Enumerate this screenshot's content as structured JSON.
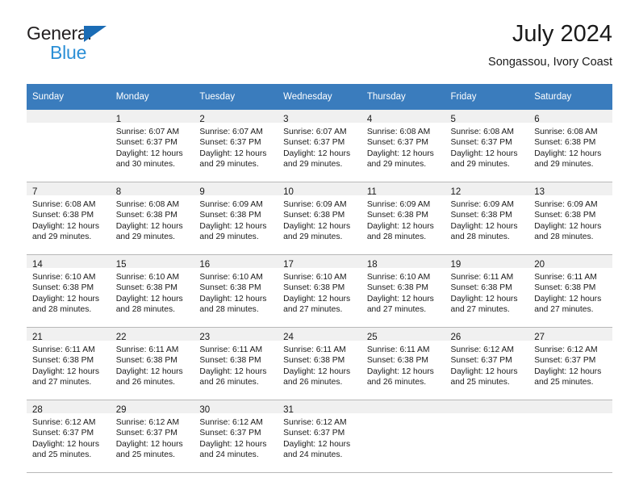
{
  "brand": {
    "name_top": "General",
    "name_bottom": "Blue",
    "triangle_color": "#1b6cb5",
    "bottom_color": "#2b8fd6"
  },
  "header": {
    "title": "July 2024",
    "subtitle": "Songassou, Ivory Coast",
    "header_bg": "#3a7cbd",
    "daynum_band_bg": "#f0f0f0",
    "grid_line_color": "#b8b8b8"
  },
  "weekday_headers": [
    "Sunday",
    "Monday",
    "Tuesday",
    "Wednesday",
    "Thursday",
    "Friday",
    "Saturday"
  ],
  "weeks": [
    [
      {
        "day": "",
        "lines": []
      },
      {
        "day": "1",
        "lines": [
          "Sunrise: 6:07 AM",
          "Sunset: 6:37 PM",
          "Daylight: 12 hours",
          "and 30 minutes."
        ]
      },
      {
        "day": "2",
        "lines": [
          "Sunrise: 6:07 AM",
          "Sunset: 6:37 PM",
          "Daylight: 12 hours",
          "and 29 minutes."
        ]
      },
      {
        "day": "3",
        "lines": [
          "Sunrise: 6:07 AM",
          "Sunset: 6:37 PM",
          "Daylight: 12 hours",
          "and 29 minutes."
        ]
      },
      {
        "day": "4",
        "lines": [
          "Sunrise: 6:08 AM",
          "Sunset: 6:37 PM",
          "Daylight: 12 hours",
          "and 29 minutes."
        ]
      },
      {
        "day": "5",
        "lines": [
          "Sunrise: 6:08 AM",
          "Sunset: 6:37 PM",
          "Daylight: 12 hours",
          "and 29 minutes."
        ]
      },
      {
        "day": "6",
        "lines": [
          "Sunrise: 6:08 AM",
          "Sunset: 6:38 PM",
          "Daylight: 12 hours",
          "and 29 minutes."
        ]
      }
    ],
    [
      {
        "day": "7",
        "lines": [
          "Sunrise: 6:08 AM",
          "Sunset: 6:38 PM",
          "Daylight: 12 hours",
          "and 29 minutes."
        ]
      },
      {
        "day": "8",
        "lines": [
          "Sunrise: 6:08 AM",
          "Sunset: 6:38 PM",
          "Daylight: 12 hours",
          "and 29 minutes."
        ]
      },
      {
        "day": "9",
        "lines": [
          "Sunrise: 6:09 AM",
          "Sunset: 6:38 PM",
          "Daylight: 12 hours",
          "and 29 minutes."
        ]
      },
      {
        "day": "10",
        "lines": [
          "Sunrise: 6:09 AM",
          "Sunset: 6:38 PM",
          "Daylight: 12 hours",
          "and 29 minutes."
        ]
      },
      {
        "day": "11",
        "lines": [
          "Sunrise: 6:09 AM",
          "Sunset: 6:38 PM",
          "Daylight: 12 hours",
          "and 28 minutes."
        ]
      },
      {
        "day": "12",
        "lines": [
          "Sunrise: 6:09 AM",
          "Sunset: 6:38 PM",
          "Daylight: 12 hours",
          "and 28 minutes."
        ]
      },
      {
        "day": "13",
        "lines": [
          "Sunrise: 6:09 AM",
          "Sunset: 6:38 PM",
          "Daylight: 12 hours",
          "and 28 minutes."
        ]
      }
    ],
    [
      {
        "day": "14",
        "lines": [
          "Sunrise: 6:10 AM",
          "Sunset: 6:38 PM",
          "Daylight: 12 hours",
          "and 28 minutes."
        ]
      },
      {
        "day": "15",
        "lines": [
          "Sunrise: 6:10 AM",
          "Sunset: 6:38 PM",
          "Daylight: 12 hours",
          "and 28 minutes."
        ]
      },
      {
        "day": "16",
        "lines": [
          "Sunrise: 6:10 AM",
          "Sunset: 6:38 PM",
          "Daylight: 12 hours",
          "and 28 minutes."
        ]
      },
      {
        "day": "17",
        "lines": [
          "Sunrise: 6:10 AM",
          "Sunset: 6:38 PM",
          "Daylight: 12 hours",
          "and 27 minutes."
        ]
      },
      {
        "day": "18",
        "lines": [
          "Sunrise: 6:10 AM",
          "Sunset: 6:38 PM",
          "Daylight: 12 hours",
          "and 27 minutes."
        ]
      },
      {
        "day": "19",
        "lines": [
          "Sunrise: 6:11 AM",
          "Sunset: 6:38 PM",
          "Daylight: 12 hours",
          "and 27 minutes."
        ]
      },
      {
        "day": "20",
        "lines": [
          "Sunrise: 6:11 AM",
          "Sunset: 6:38 PM",
          "Daylight: 12 hours",
          "and 27 minutes."
        ]
      }
    ],
    [
      {
        "day": "21",
        "lines": [
          "Sunrise: 6:11 AM",
          "Sunset: 6:38 PM",
          "Daylight: 12 hours",
          "and 27 minutes."
        ]
      },
      {
        "day": "22",
        "lines": [
          "Sunrise: 6:11 AM",
          "Sunset: 6:38 PM",
          "Daylight: 12 hours",
          "and 26 minutes."
        ]
      },
      {
        "day": "23",
        "lines": [
          "Sunrise: 6:11 AM",
          "Sunset: 6:38 PM",
          "Daylight: 12 hours",
          "and 26 minutes."
        ]
      },
      {
        "day": "24",
        "lines": [
          "Sunrise: 6:11 AM",
          "Sunset: 6:38 PM",
          "Daylight: 12 hours",
          "and 26 minutes."
        ]
      },
      {
        "day": "25",
        "lines": [
          "Sunrise: 6:11 AM",
          "Sunset: 6:38 PM",
          "Daylight: 12 hours",
          "and 26 minutes."
        ]
      },
      {
        "day": "26",
        "lines": [
          "Sunrise: 6:12 AM",
          "Sunset: 6:37 PM",
          "Daylight: 12 hours",
          "and 25 minutes."
        ]
      },
      {
        "day": "27",
        "lines": [
          "Sunrise: 6:12 AM",
          "Sunset: 6:37 PM",
          "Daylight: 12 hours",
          "and 25 minutes."
        ]
      }
    ],
    [
      {
        "day": "28",
        "lines": [
          "Sunrise: 6:12 AM",
          "Sunset: 6:37 PM",
          "Daylight: 12 hours",
          "and 25 minutes."
        ]
      },
      {
        "day": "29",
        "lines": [
          "Sunrise: 6:12 AM",
          "Sunset: 6:37 PM",
          "Daylight: 12 hours",
          "and 25 minutes."
        ]
      },
      {
        "day": "30",
        "lines": [
          "Sunrise: 6:12 AM",
          "Sunset: 6:37 PM",
          "Daylight: 12 hours",
          "and 24 minutes."
        ]
      },
      {
        "day": "31",
        "lines": [
          "Sunrise: 6:12 AM",
          "Sunset: 6:37 PM",
          "Daylight: 12 hours",
          "and 24 minutes."
        ]
      },
      {
        "day": "",
        "lines": []
      },
      {
        "day": "",
        "lines": []
      },
      {
        "day": "",
        "lines": []
      }
    ]
  ]
}
